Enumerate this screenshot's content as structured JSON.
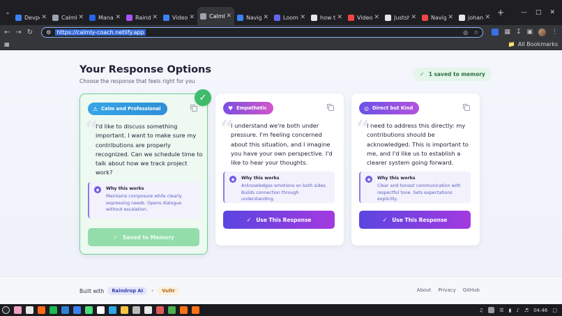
{
  "browser": {
    "tabs": [
      {
        "title": "Devpost",
        "color": "#3b82f6"
      },
      {
        "title": "Calmly",
        "color": "#9ca3af"
      },
      {
        "title": "Manage",
        "color": "#2563eb"
      },
      {
        "title": "Raindrop",
        "color": "#a855f7"
      },
      {
        "title": "Videos",
        "color": "#3b82f6"
      },
      {
        "title": "Calmly",
        "color": "#9ca3af",
        "active": true
      },
      {
        "title": "Navigat",
        "color": "#3b82f6"
      },
      {
        "title": "Loom s",
        "color": "#6366f1"
      },
      {
        "title": "how to",
        "color": "#e5e7eb"
      },
      {
        "title": "Video d",
        "color": "#ef4444"
      },
      {
        "title": "Justsha",
        "color": "#e5e7eb"
      },
      {
        "title": "Navigat",
        "color": "#ef4444"
      },
      {
        "title": "johann",
        "color": "#e5e7eb"
      }
    ],
    "url": "https://calmly-coach.netlify.app",
    "all_bookmarks": "All Bookmarks"
  },
  "page": {
    "title": "Your Response Options",
    "subtitle": "Choose the response that feels right for you",
    "saved_pill": "1 saved to memory"
  },
  "cards": [
    {
      "tag": "Calm and Professional",
      "tag_icon": "warning-icon",
      "quote": "I'd like to discuss something important. I want to make sure my contributions are properly recognized. Can we schedule time to talk about how we track project work?",
      "why_title": "Why this works",
      "why_body": "Maintains composure while clearly expressing needs. Opens dialogue without escalation.",
      "button": "Saved to Memory",
      "selected": true
    },
    {
      "tag": "Empathetic",
      "tag_icon": "heart-icon",
      "quote": "I understand we're both under pressure. I'm feeling concerned about this situation, and I imagine you have your own perspective. I'd like to hear your thoughts.",
      "why_title": "Why this works",
      "why_body": "Acknowledges emotions on both sides. Builds connection through understanding.",
      "button": "Use This Response"
    },
    {
      "tag": "Direct but Kind",
      "tag_icon": "target-icon",
      "quote": "I need to address this directly: my contributions should be acknowledged. This is important to me, and I'd like us to establish a clearer system going forward.",
      "why_title": "Why this works",
      "why_body": "Clear and honest communication with respectful tone. Sets expectations explicitly.",
      "button": "Use This Response"
    }
  ],
  "footer": {
    "built_with": "Built with",
    "chip1": "Raindrop AI",
    "plus": "+",
    "chip2": "Vultr",
    "links": [
      "About",
      "Privacy",
      "GitHub"
    ]
  },
  "taskbar": {
    "clock": "04:46",
    "icons": [
      "#f0a0c0",
      "#e8e8e8",
      "#ff6a1a",
      "#1db954",
      "#2f7fd8",
      "#3b82f6",
      "#4ade80",
      "#ffffff",
      "#2fa8e8",
      "#f5c542",
      "#bbbbbb",
      "#e8e8e8",
      "#e05a5a",
      "#4caf50",
      "#f97316",
      "#f97316"
    ]
  }
}
